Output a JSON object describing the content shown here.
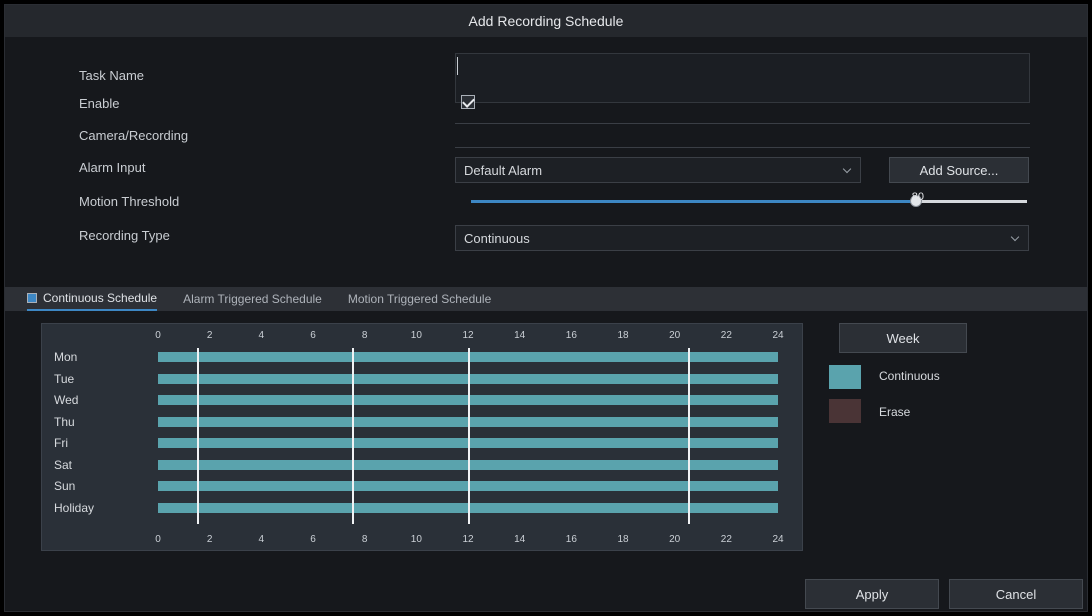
{
  "dialog": {
    "title": "Add Recording Schedule"
  },
  "form": {
    "labels": [
      "Task Name",
      "Enable",
      "Camera/Recording",
      "Alarm Input",
      "Motion Threshold",
      "Recording Type"
    ],
    "task_name_value": "",
    "enable_checked": true,
    "alarm_input_value": "Default Alarm",
    "add_source_label": "Add Source...",
    "slider": {
      "value": 80,
      "percent": 80,
      "label": "80"
    },
    "recording_type_value": "Continuous"
  },
  "tabs": [
    "Continuous Schedule",
    "Alarm Triggered Schedule",
    "Motion Triggered Schedule"
  ],
  "schedule": {
    "hours": [
      "0",
      "2",
      "4",
      "6",
      "8",
      "10",
      "12",
      "14",
      "16",
      "18",
      "20",
      "22",
      "24"
    ],
    "days": [
      "Mon",
      "Tue",
      "Wed",
      "Thu",
      "Fri",
      "Sat",
      "Sun",
      "Holiday"
    ],
    "bar_color": "#5aa3ad"
  },
  "legend": {
    "title": "Week",
    "items": [
      {
        "label": "Continuous",
        "color": "#5aa3ad"
      },
      {
        "label": "Erase",
        "color": "#4a3436"
      }
    ]
  },
  "footer": {
    "apply_label": "Apply",
    "cancel_label": "Cancel"
  }
}
